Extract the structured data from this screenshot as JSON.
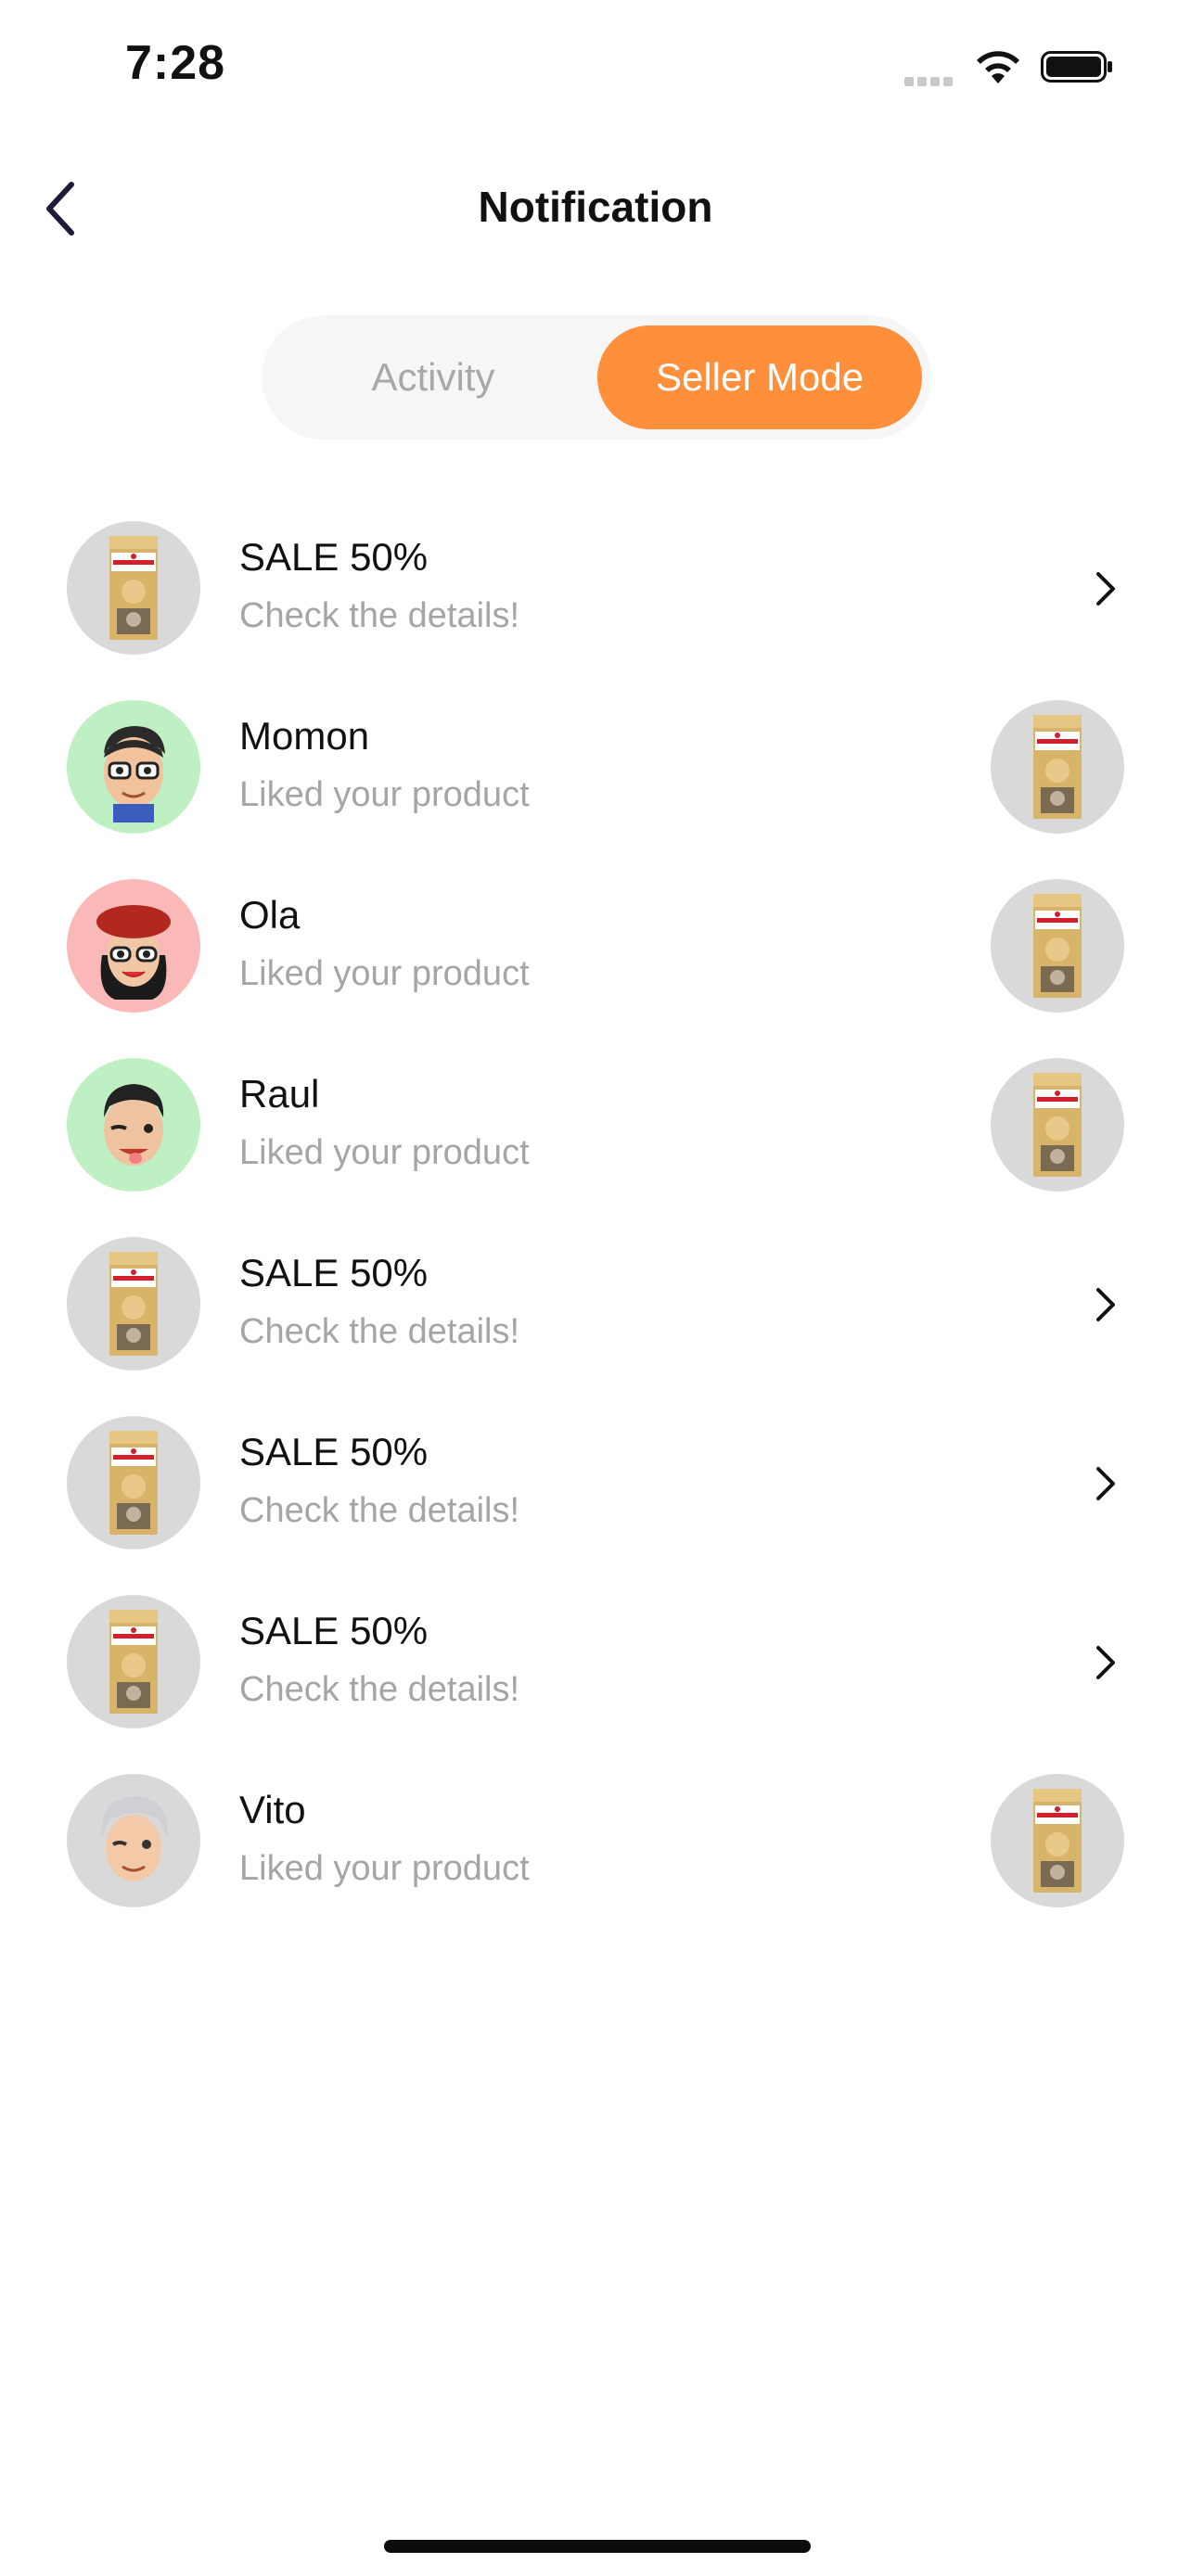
{
  "status_bar": {
    "time": "7:28"
  },
  "header": {
    "title": "Notification"
  },
  "tabs": [
    {
      "label": "Activity",
      "active": false
    },
    {
      "label": "Seller Mode",
      "active": true
    }
  ],
  "colors": {
    "accent": "#ff8f3a",
    "muted_text": "#a5a5a5",
    "segment_bg": "#f6f6f6"
  },
  "notifications": [
    {
      "title": "SALE 50%",
      "subtitle": "Check the details!",
      "avatar": "product-bag",
      "trailing": "chevron"
    },
    {
      "title": "Momon",
      "subtitle": "Liked your product",
      "avatar": "memoji-glasses-man",
      "trailing": "product-thumbnail"
    },
    {
      "title": "Ola",
      "subtitle": "Liked your product",
      "avatar": "memoji-beret-woman",
      "trailing": "product-thumbnail"
    },
    {
      "title": "Raul",
      "subtitle": "Liked your product",
      "avatar": "memoji-wink-man",
      "trailing": "product-thumbnail"
    },
    {
      "title": "SALE 50%",
      "subtitle": "Check the details!",
      "avatar": "product-bag",
      "trailing": "chevron"
    },
    {
      "title": "SALE 50%",
      "subtitle": "Check the details!",
      "avatar": "product-bag",
      "trailing": "chevron"
    },
    {
      "title": "SALE 50%",
      "subtitle": "Check the details!",
      "avatar": "product-bag",
      "trailing": "chevron"
    },
    {
      "title": "Vito",
      "subtitle": "Liked your product",
      "avatar": "memoji-silver-hair",
      "trailing": "product-thumbnail"
    }
  ]
}
